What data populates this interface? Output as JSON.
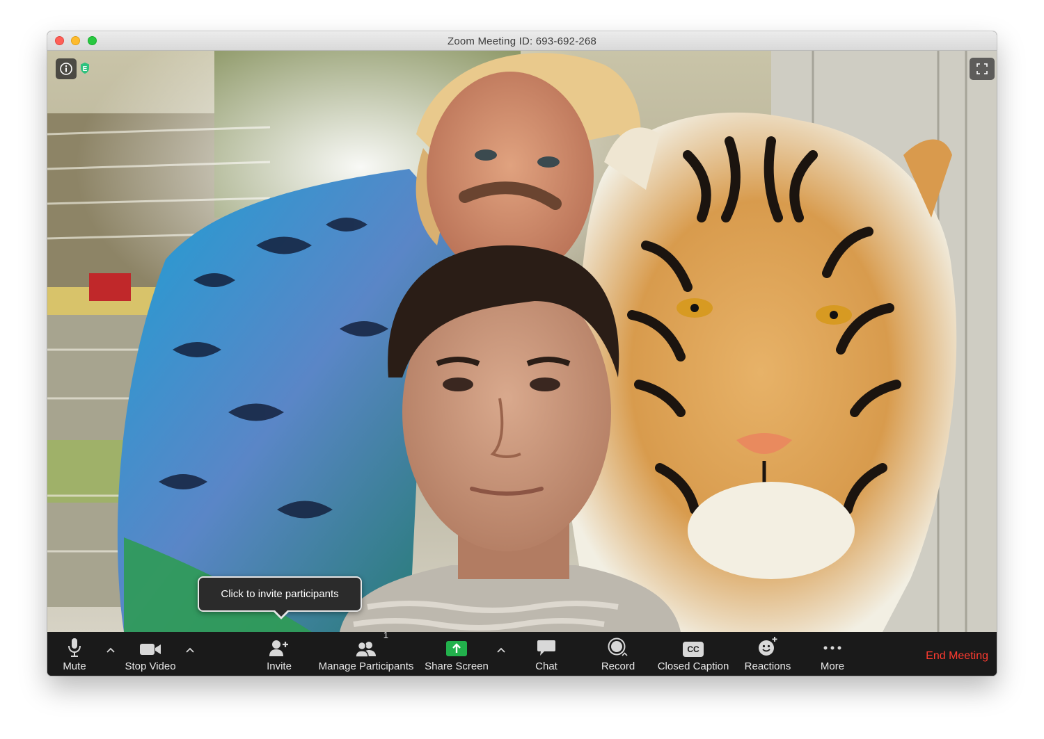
{
  "window": {
    "title": "Zoom Meeting ID: 693-692-268"
  },
  "overlay": {
    "tooltip": "Click to invite participants",
    "encryption_badge_letter": "E"
  },
  "toolbar": {
    "mute": "Mute",
    "stop_video": "Stop Video",
    "invite": "Invite",
    "manage_participants": "Manage Participants",
    "participant_count": "1",
    "share_screen": "Share Screen",
    "chat": "Chat",
    "record": "Record",
    "closed_caption": "Closed Caption",
    "closed_caption_icon_text": "CC",
    "reactions": "Reactions",
    "more": "More",
    "end_meeting": "End Meeting"
  },
  "colors": {
    "end_meeting": "#ff3b30",
    "share_screen_green": "#22b14c",
    "toolbar_bg": "#1a1a1a"
  },
  "icons": {
    "mute": "microphone-icon",
    "stop_video": "video-camera-icon",
    "invite": "add-person-icon",
    "manage_participants": "participants-icon",
    "share_screen": "share-screen-arrow-icon",
    "chat": "chat-bubble-icon",
    "record": "record-circle-icon",
    "closed_caption": "cc-icon",
    "reactions": "smiley-plus-icon",
    "more": "ellipsis-icon"
  }
}
